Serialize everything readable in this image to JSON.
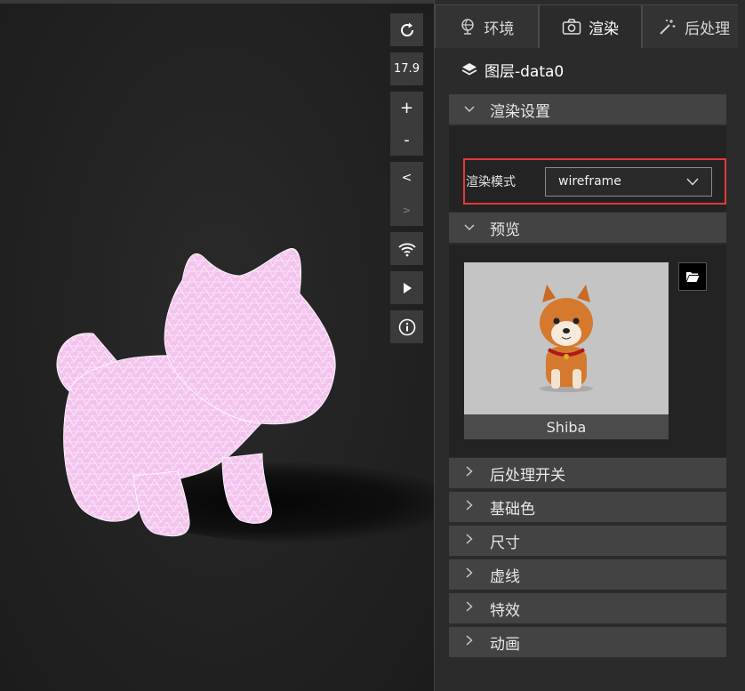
{
  "toolbar": {
    "refresh_icon": "refresh-icon",
    "zoom_value": "17.9",
    "zoom_in": "+",
    "zoom_out": "-",
    "prev": "<",
    "next": ">"
  },
  "tabs": [
    {
      "label": "环境",
      "icon": "globe-icon"
    },
    {
      "label": "渲染",
      "icon": "camera-icon"
    },
    {
      "label": "后处理",
      "icon": "magic-wand-icon"
    }
  ],
  "layer_title": "图层-data0",
  "render_section": {
    "title": "渲染设置",
    "mode_label": "渲染模式",
    "mode_value": "wireframe"
  },
  "preview_section": {
    "title": "预览",
    "model_name": "Shiba"
  },
  "collapsed_sections": [
    "后处理开关",
    "基础色",
    "尺寸",
    "虚线",
    "特效",
    "动画"
  ],
  "colors": {
    "highlight_border": "#e53935",
    "model_wireframe": "#f4c4f0"
  }
}
